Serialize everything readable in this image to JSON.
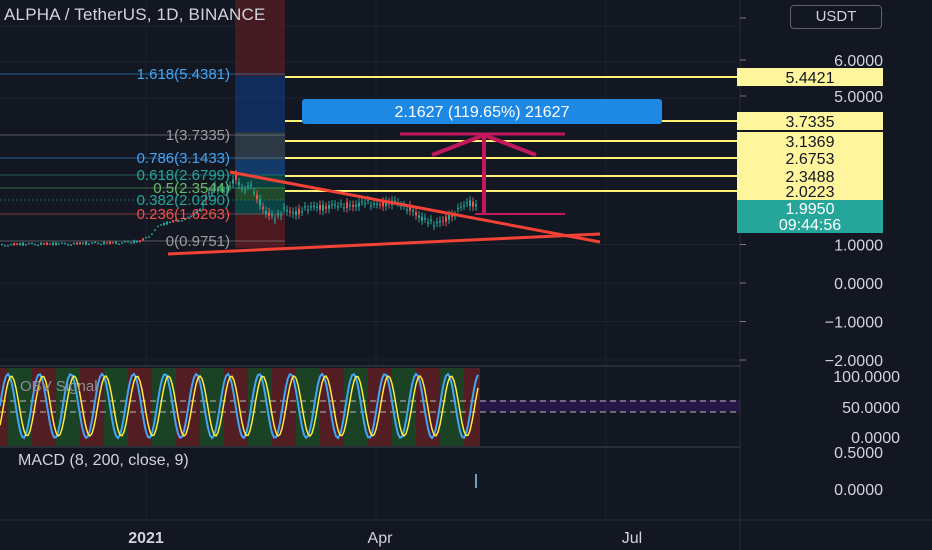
{
  "header": {
    "title": "ALPHA / TetherUS, 1D, BINANCE",
    "currency_button": "USDT",
    "obv_caption": "OBV Signal",
    "macd_caption": "MACD (8, 200, close, 9)"
  },
  "colors": {
    "background": "#131722",
    "up": "#26a69a",
    "down": "#ef5350",
    "fib_line": "#fff176",
    "trend_line": "#f44336",
    "arrow": "#c2185b",
    "measure_box": "#1e88e5",
    "price_tag": "#26a69a"
  },
  "chart_data": [
    {
      "type": "candlestick",
      "price_axis": {
        "ticks": [
          "−2.0000",
          "−1.0000",
          "0.0000",
          "1.0000",
          "1.9950",
          "2.0223",
          "2.3488",
          "2.6753",
          "3.1369",
          "3.7335",
          "5.0000",
          "5.4421",
          "6.0000",
          "7"
        ],
        "grid_values": [
          -2,
          -1,
          0,
          1,
          5,
          6,
          7
        ]
      },
      "time_axis": {
        "ticks": [
          "2021",
          "Apr",
          "Jul"
        ]
      },
      "current_price": {
        "value": "1.9950",
        "countdown": "09:44:56"
      },
      "fib_retracement": {
        "levels": [
          {
            "label": "1.618(5.4381)",
            "color": "#42a5f5"
          },
          {
            "label": "1(3.7335)",
            "color": "#9e9e9e"
          },
          {
            "label": "0.786(3.1433)",
            "color": "#42a5f5"
          },
          {
            "label": "0.618(2.6799)",
            "color": "#26a69a"
          },
          {
            "label": "0.5(2.3544)",
            "color": "#66bb6a"
          },
          {
            "label": "0.382(2.0290)",
            "color": "#26a69a"
          },
          {
            "label": "0.236(1.6263)",
            "color": "#ef5350"
          },
          {
            "label": "0(0.9751)",
            "color": "#9e9e9e"
          }
        ]
      },
      "horizontal_levels": [
        5.4421,
        3.7335,
        3.1369,
        2.6753,
        2.3488,
        2.0223,
        1.995
      ],
      "measure": {
        "label": "2.1627 (119.65%) 21627",
        "from": 1.6263,
        "to": 3.7335
      },
      "triangle": {
        "upper_line": [
          {
            "date": "2021-01-25",
            "price": 2.65
          },
          {
            "date": "2021-05-12",
            "price": 1.0
          }
        ],
        "lower_line": [
          {
            "date": "2021-01-01",
            "price": 0.9
          },
          {
            "date": "2021-05-14",
            "price": 1.25
          }
        ]
      }
    },
    {
      "type": "line",
      "title": "OBV Signal",
      "value_axis": {
        "ticks": [
          "0.0000",
          "50.0000",
          "100.0000"
        ]
      },
      "bands": [
        20,
        80
      ]
    },
    {
      "type": "bar",
      "title": "MACD (8, 200, close, 9)",
      "value_axis": {
        "ticks": [
          "0.0000",
          "0.5000"
        ]
      }
    }
  ]
}
